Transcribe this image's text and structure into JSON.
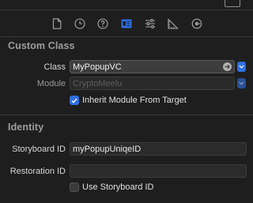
{
  "toolbar": {
    "tabs": [
      {
        "name": "file-inspector",
        "icon": "document-icon",
        "selected": false
      },
      {
        "name": "history-inspector",
        "icon": "clock-icon",
        "selected": false
      },
      {
        "name": "quick-help-inspector",
        "icon": "question-circle-icon",
        "selected": false
      },
      {
        "name": "identity-inspector",
        "icon": "id-card-icon",
        "selected": true
      },
      {
        "name": "attributes-inspector",
        "icon": "sliders-icon",
        "selected": false
      },
      {
        "name": "size-inspector",
        "icon": "ruler-icon",
        "selected": false
      },
      {
        "name": "connections-inspector",
        "icon": "arrow-circle-icon",
        "selected": false
      }
    ],
    "accent_color": "#2f6fe0"
  },
  "custom_class": {
    "title": "Custom Class",
    "class_label": "Class",
    "class_value": "MyPopupVC",
    "module_label": "Module",
    "module_placeholder": "CryptoMeelu",
    "inherit_label": "Inherit Module From Target",
    "inherit_checked": true
  },
  "identity": {
    "title": "Identity",
    "storyboard_id_label": "Storyboard ID",
    "storyboard_id_value": "myPopupUniqeID",
    "restoration_id_label": "Restoration ID",
    "restoration_id_value": "",
    "use_storyboard_label": "Use Storyboard ID",
    "use_storyboard_checked": false
  }
}
